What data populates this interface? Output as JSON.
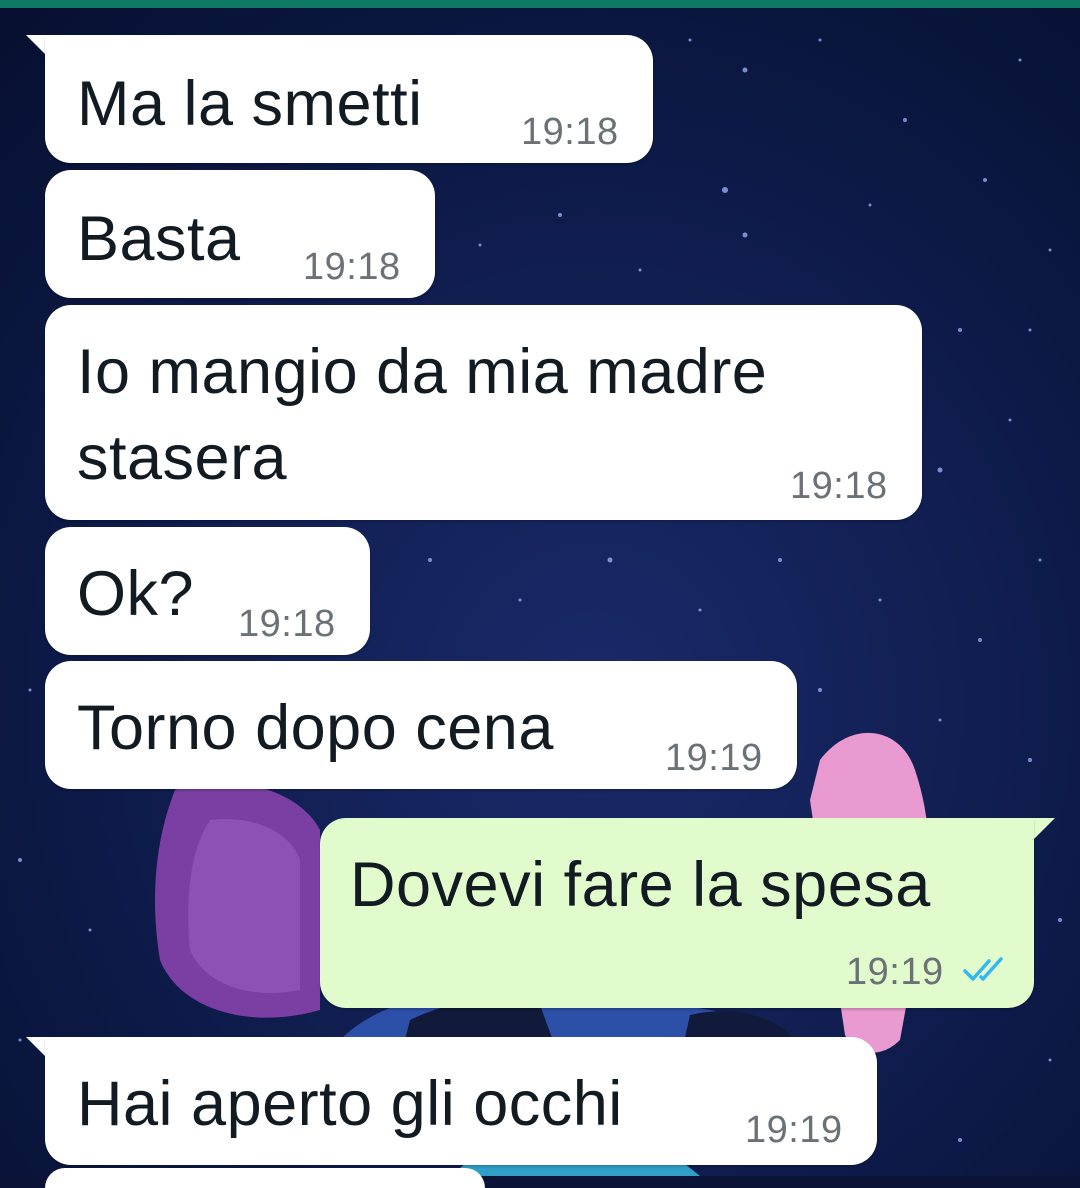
{
  "chat": {
    "messages": [
      {
        "direction": "in",
        "text": "Ma la smetti",
        "time": "19:18"
      },
      {
        "direction": "in",
        "text": "Basta",
        "time": "19:18"
      },
      {
        "direction": "in",
        "text_line1": "Io mangio da mia madre",
        "text_line2": "stasera",
        "time": "19:18"
      },
      {
        "direction": "in",
        "text": "Ok?",
        "time": "19:18"
      },
      {
        "direction": "in",
        "text": "Torno dopo cena",
        "time": "19:19"
      },
      {
        "direction": "out",
        "text": "Dovevi fare la spesa",
        "time": "19:19",
        "status": "read"
      },
      {
        "direction": "in",
        "text": "Hai aperto gli occhi",
        "time": "19:19"
      }
    ]
  },
  "icons": {
    "read_receipt": "double-check-icon"
  },
  "colors": {
    "header_accent": "#0e7a63",
    "incoming_bubble": "#ffffff",
    "outgoing_bubble": "#e2fbcd",
    "read_tick": "#34b7f1",
    "wallpaper": "#0b1436"
  }
}
